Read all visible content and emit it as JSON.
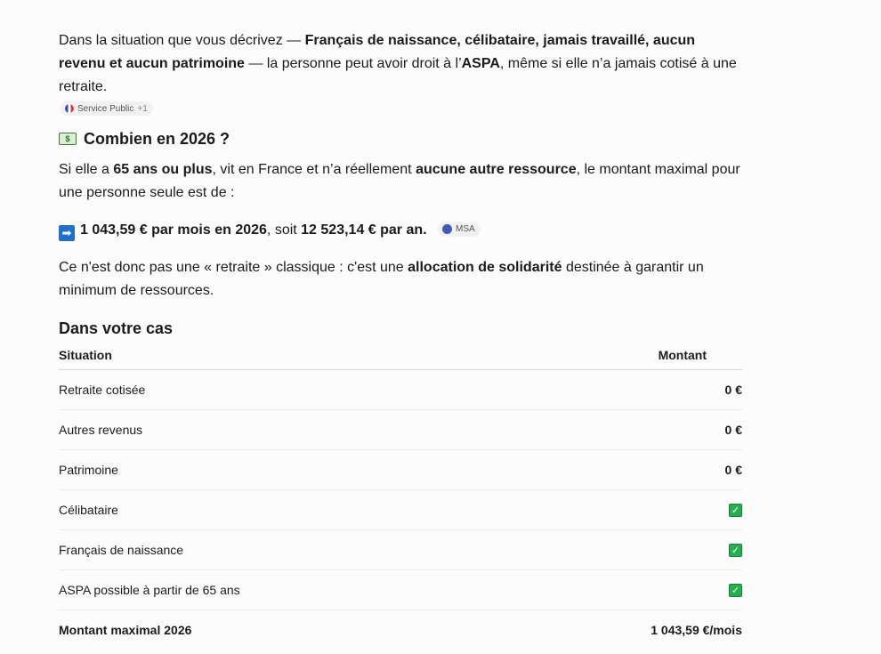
{
  "intro": {
    "t1": "Dans la situation que vous décrivez — ",
    "b1": "Français de naissance, célibataire, jamais travaillé, aucun revenu et aucun patrimoine",
    "t2": " — la personne peut avoir droit à l’",
    "b2": "ASPA",
    "t3": ", même si elle n’a jamais cotisé à une retraite.",
    "source": {
      "label": "Service Public",
      "more": "+1"
    }
  },
  "section_combien": {
    "icon": "money-icon",
    "title": "Combien en 2026 ?",
    "p1": {
      "t1": "Si elle a ",
      "b1": "65 ans ou plus",
      "t2": ", vit en France et n’a réellement ",
      "b2": "aucune autre ressource",
      "t3": ", le montant maximal pour une personne seule est de :"
    },
    "amount": {
      "arrow": "➡",
      "b1": "1 043,59 € par mois en 2026",
      "t1": ", soit ",
      "b2": "12 523,14 € par an.",
      "source": "MSA"
    },
    "p2": {
      "t1": "Ce n'est donc pas une « retraite » classique : c'est une ",
      "b1": "allocation de solidarité",
      "t2": " destinée à garantir un minimum de ressources."
    }
  },
  "section_cas": {
    "title": "Dans votre cas",
    "headers": {
      "situation": "Situation",
      "montant": "Montant"
    },
    "rows": [
      {
        "label": "Retraite cotisée",
        "value": "0 €"
      },
      {
        "label": "Autres revenus",
        "value": "0 €"
      },
      {
        "label": "Patrimoine",
        "value": "0 €"
      },
      {
        "label": "Célibataire",
        "check": "✓"
      },
      {
        "label": "Français de naissance",
        "check": "✓"
      },
      {
        "label": "ASPA possible à partir de 65 ans",
        "check": "✓"
      }
    ],
    "total": {
      "label": "Montant maximal 2026",
      "value": "1 043,59 €/mois"
    }
  },
  "colors": {
    "check_green": "#22b24c",
    "arrow_blue": "#1f6fd1"
  }
}
